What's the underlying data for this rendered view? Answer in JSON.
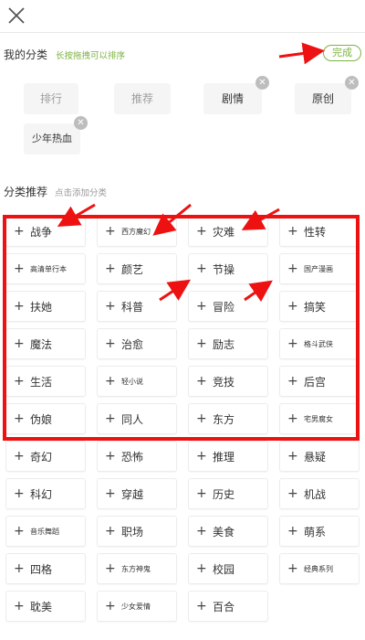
{
  "my_categories": {
    "title": "我的分类",
    "hint": "长按拖拽可以排序",
    "done_label": "完成",
    "tags": [
      {
        "label": "排行",
        "removable": false
      },
      {
        "label": "推荐",
        "removable": false
      },
      {
        "label": "剧情",
        "removable": true
      },
      {
        "label": "原创",
        "removable": true
      },
      {
        "label": "少年热血",
        "removable": true
      }
    ]
  },
  "recommended": {
    "title": "分类推荐",
    "hint": "点击添加分类",
    "items": [
      {
        "label": "战争",
        "small": false
      },
      {
        "label": "西方魔幻",
        "small": true
      },
      {
        "label": "灾难",
        "small": false
      },
      {
        "label": "性转",
        "small": false
      },
      {
        "label": "高清单行本",
        "small": true
      },
      {
        "label": "颜艺",
        "small": false
      },
      {
        "label": "节操",
        "small": false
      },
      {
        "label": "国产漫画",
        "small": true
      },
      {
        "label": "扶她",
        "small": false
      },
      {
        "label": "科普",
        "small": false
      },
      {
        "label": "冒险",
        "small": false
      },
      {
        "label": "搞笑",
        "small": false
      },
      {
        "label": "魔法",
        "small": false
      },
      {
        "label": "治愈",
        "small": false
      },
      {
        "label": "励志",
        "small": false
      },
      {
        "label": "格斗武侠",
        "small": true
      },
      {
        "label": "生活",
        "small": false
      },
      {
        "label": "轻小说",
        "small": true
      },
      {
        "label": "竞技",
        "small": false
      },
      {
        "label": "后宫",
        "small": false
      },
      {
        "label": "伪娘",
        "small": false
      },
      {
        "label": "同人",
        "small": false
      },
      {
        "label": "东方",
        "small": false
      },
      {
        "label": "宅男腐女",
        "small": true
      },
      {
        "label": "奇幻",
        "small": false
      },
      {
        "label": "恐怖",
        "small": false
      },
      {
        "label": "推理",
        "small": false
      },
      {
        "label": "悬疑",
        "small": false
      },
      {
        "label": "科幻",
        "small": false
      },
      {
        "label": "穿越",
        "small": false
      },
      {
        "label": "历史",
        "small": false
      },
      {
        "label": "机战",
        "small": false
      },
      {
        "label": "音乐舞蹈",
        "small": true
      },
      {
        "label": "职场",
        "small": false
      },
      {
        "label": "美食",
        "small": false
      },
      {
        "label": "萌系",
        "small": false
      },
      {
        "label": "四格",
        "small": false
      },
      {
        "label": "东方神鬼",
        "small": true
      },
      {
        "label": "校园",
        "small": false
      },
      {
        "label": "经典系列",
        "small": true
      },
      {
        "label": "耽美",
        "small": false
      },
      {
        "label": "少女爱情",
        "small": true
      },
      {
        "label": "百合",
        "small": false
      }
    ]
  },
  "colors": {
    "accent_green": "#7cb342",
    "annotation_red": "#ee1111"
  },
  "icons": {
    "close": "close-icon",
    "remove": "remove-tag-icon",
    "add": "plus-icon"
  }
}
